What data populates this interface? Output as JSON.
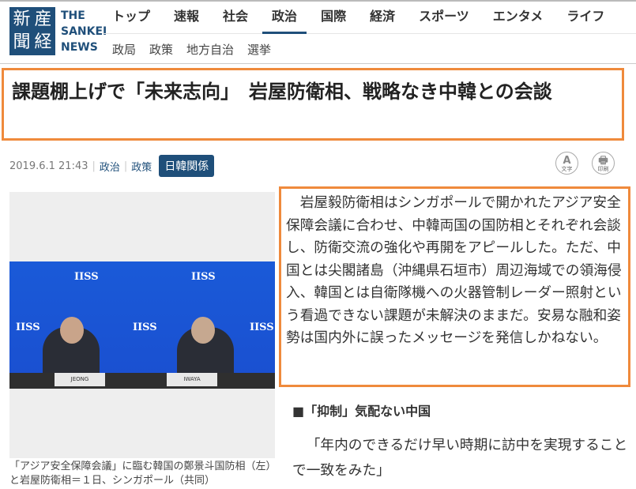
{
  "logo": {
    "kanji": [
      "新",
      "産",
      "聞",
      "経"
    ],
    "english": [
      "THE",
      "SANKEI",
      "NEWS"
    ]
  },
  "nav": {
    "items": [
      "トップ",
      "速報",
      "社会",
      "政治",
      "国際",
      "経済",
      "スポーツ",
      "エンタメ",
      "ライフ"
    ],
    "active": "政治"
  },
  "subnav": [
    "政局",
    "政策",
    "地方自治",
    "選挙"
  ],
  "article": {
    "title": "課題棚上げで「未来志向」　岩屋防衛相、戦略なき中韓との会談",
    "date": "2019.6.1 21:43",
    "categories": [
      "政治",
      "政策"
    ],
    "tag": "日韓関係",
    "tools": {
      "text_size": "文字",
      "print": "印刷",
      "text_size_glyph": "A",
      "print_glyph": "🖶"
    },
    "photo": {
      "logo_text": "IISS",
      "nameplates": [
        "JEONG",
        "IWAYA"
      ]
    },
    "caption": "「アジア安全保障会議」に臨む韓国の鄭景斗国防相（左）と岩屋防衛相＝１日、シンガポール（共同）",
    "lead": "岩屋毅防衛相はシンガポールで開かれたアジア安全保障会議に合わせ、中韓両国の国防相とそれぞれ会談し、防衛交流の強化や再開をアピールした。ただ、中国とは尖閣諸島（沖縄県石垣市）周辺海域での領海侵入、韓国とは自衛隊機への火器管制レーダー照射という看過できない課題が未解決のままだ。安易な融和姿勢は国内外に誤ったメッセージを発信しかねない。",
    "subheading": "■「抑制」気配ない中国",
    "paragraph2": "「年内のできるだけ早い時期に訪中を実現することで一致をみた」"
  },
  "colors": {
    "brand": "#1f4f7a",
    "highlight": "#ef8a3c"
  }
}
